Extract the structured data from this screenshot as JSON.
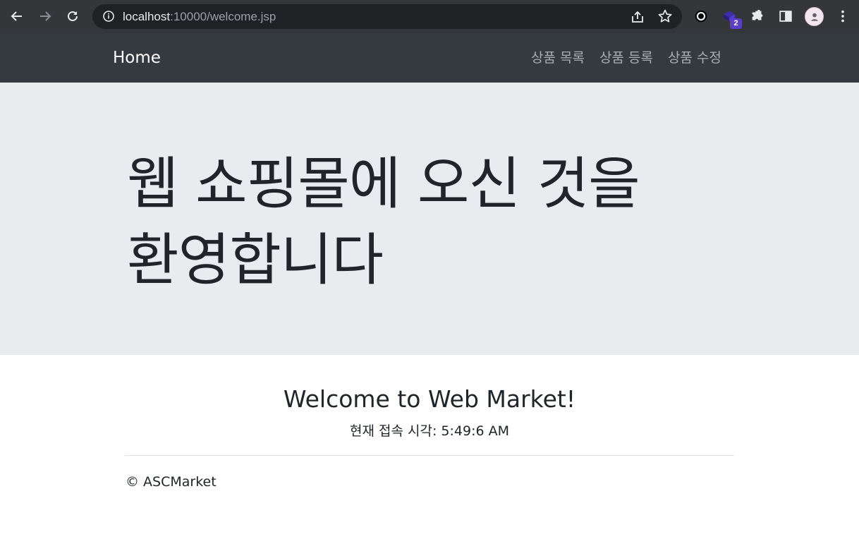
{
  "browser": {
    "url_host": "localhost",
    "url_rest": ":10000/welcome.jsp",
    "extension_badge": "2"
  },
  "navbar": {
    "brand": "Home",
    "links": [
      "상품 목록",
      "상품 등록",
      "상품 수정"
    ]
  },
  "jumbotron": {
    "title": "웹 쇼핑몰에 오신 것을 환영합니다"
  },
  "main": {
    "heading": "Welcome to Web Market!",
    "time_label": "현재 접속 시각: 5:49:6 AM"
  },
  "footer": {
    "text": "© ASCMarket"
  },
  "colors": {
    "browser_bar": "#35363a",
    "navbar": "#343a40",
    "jumbotron": "#e9ecef",
    "text": "#212529"
  }
}
